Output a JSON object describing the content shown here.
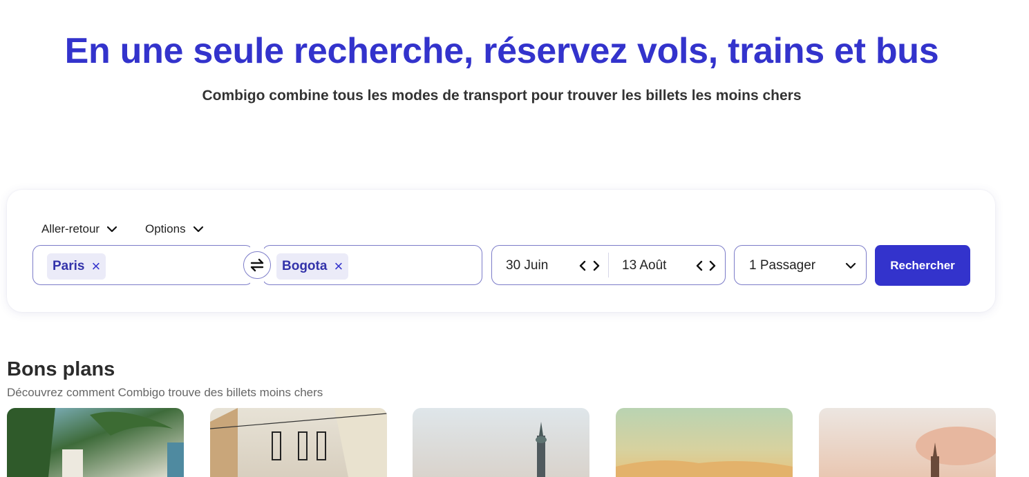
{
  "hero": {
    "title": "En une seule recherche, réservez vols, trains et bus",
    "subtitle": "Combigo combine tous les modes de transport pour trouver les billets les moins chers"
  },
  "search": {
    "trip_type": "Aller-retour",
    "options": "Options",
    "origin": "Paris",
    "destination": "Bogota",
    "remove_glyph": "×",
    "departure_date": "30 Juin",
    "return_date": "13 Août",
    "passengers": "1 Passager",
    "submit": "Rechercher"
  },
  "deals": {
    "title": "Bons plans",
    "subtitle": "Découvrez comment Combigo trouve des billets moins chers"
  },
  "colors": {
    "accent": "#3333cc",
    "border": "#7b7bc8",
    "chip_bg": "#ebebf8"
  }
}
